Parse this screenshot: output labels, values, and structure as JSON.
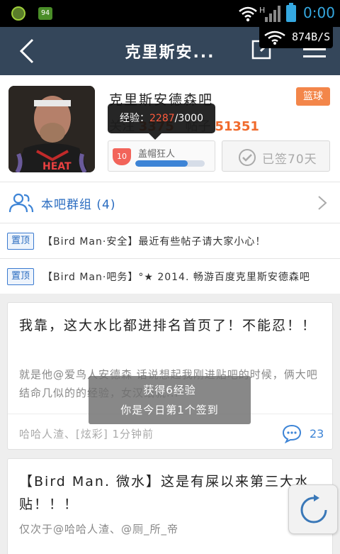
{
  "status_bar": {
    "time": "0:00",
    "battery_app_badge": "94"
  },
  "title_bar": {
    "title": "克里斯安...",
    "speed_indicator": "874B/S"
  },
  "forum": {
    "name": "克里斯安德森吧",
    "category_tag": "篮球",
    "follow_label": "关注",
    "follow_count": "3375",
    "posts_label": "帖子",
    "posts_count": "51351",
    "exp_label": "经验：",
    "exp_current": "2287",
    "exp_max": "/3000",
    "exp_progress": 0.76,
    "level_number": "10",
    "level_title": "盖帽狂人",
    "signed_label": "已签70天"
  },
  "group_row": {
    "label": "本吧群组 (4)"
  },
  "pinned_posts": [
    {
      "tag": "置顶",
      "text": "【Bird Man·安全】最近有些帖子请大家小心！"
    },
    {
      "tag": "置顶",
      "text": "【Bird Man·吧务】°★ 2014. 畅游百度克里斯安德森吧"
    }
  ],
  "posts": [
    {
      "title": "我靠，这大水比都进排名首页了！不能忍！！",
      "excerpt": "就是他@爱鸟人安德森 话说想起我刚进贴吧的时候，俩大吧结命几似的的经验，女汉纸就...",
      "meta": "哈哈人渣、[炫彩]  1分钟前",
      "comments": "23"
    },
    {
      "title": "【Bird Man. 微水】这是有屎以来第三大水贴！！！",
      "excerpt": "仅次于@哈哈人渣、@厕_所_帝"
    }
  ],
  "toast": {
    "line1": "获得6经验",
    "line2": "你是今日第1个签到"
  },
  "colors": {
    "title_bar": "#34465a",
    "accent_blue": "#3d84d6",
    "accent_orange": "#f06a2c"
  }
}
